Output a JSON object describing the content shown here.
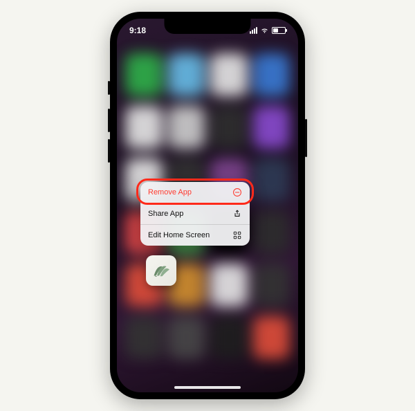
{
  "statusBar": {
    "time": "9:18"
  },
  "contextMenu": {
    "items": [
      {
        "label": "Remove App",
        "icon": "remove-circle-icon",
        "destructive": true
      },
      {
        "label": "Share App",
        "icon": "share-icon",
        "destructive": false
      },
      {
        "label": "Edit Home Screen",
        "icon": "edit-grid-icon",
        "destructive": false
      }
    ]
  }
}
